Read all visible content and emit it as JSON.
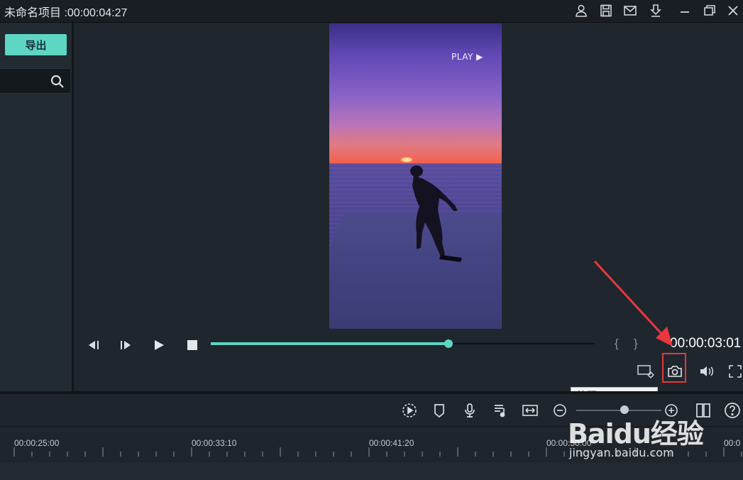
{
  "app": {
    "title": "未命名项目 :00:00:04:27"
  },
  "left_panel": {
    "export_label": "导出",
    "search_placeholder": ""
  },
  "preview": {
    "overlay_text": "PLAY ▶",
    "current_time": "00:00:03:01",
    "progress": 0.62
  },
  "tooltip": {
    "snapshot": "快照 (Ctrl+Alt+S)"
  },
  "timeline": {
    "ruler_labels": [
      "00:00:25:00",
      "00:00:33:10",
      "00:00:41:20",
      "00:00:50:00",
      "00:0"
    ]
  },
  "watermark": {
    "logo": "Baidu经验",
    "url": "jingyan.baidu.com"
  },
  "colors": {
    "accent": "#5ed6c4",
    "highlight": "#e43a3a",
    "arrow": "#e8383d"
  },
  "icons": {
    "titlebar": [
      "user-icon",
      "save-icon",
      "mail-icon",
      "download-icon",
      "minimize-icon",
      "restore-icon",
      "close-icon"
    ],
    "playback": [
      "prev-frame-icon",
      "next-frame-icon",
      "play-icon",
      "stop-icon"
    ],
    "preview_tools": [
      "display-settings-icon",
      "camera-icon",
      "volume-icon",
      "fullscreen-icon"
    ],
    "timeline_tools": [
      "render-preview-icon",
      "marker-icon",
      "microphone-icon",
      "audio-mixer-icon",
      "fit-timeline-icon",
      "zoom-out-icon",
      "zoom-in-icon",
      "split-view-icon",
      "help-icon"
    ]
  }
}
